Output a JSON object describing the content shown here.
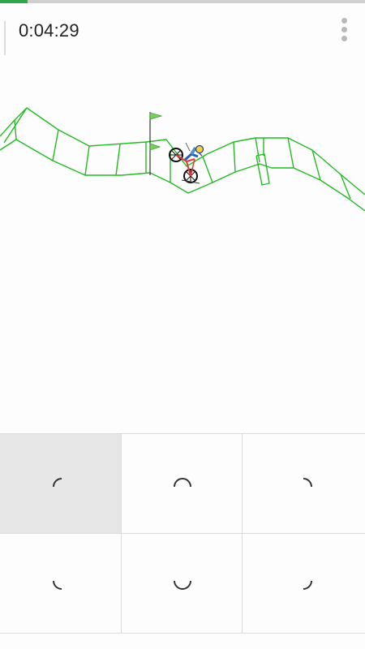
{
  "hud": {
    "timer": "0:04:29",
    "progress": 0.075,
    "progress_color": "#2ea84a"
  },
  "menu": {
    "icon": "more-vert-icon"
  },
  "track": {
    "line_color": "#22bb22"
  },
  "controls": [
    {
      "name": "control-up-left",
      "icon": "arc-up-left-icon",
      "pressed": true
    },
    {
      "name": "control-up",
      "icon": "arc-up-icon",
      "pressed": false
    },
    {
      "name": "control-up-right",
      "icon": "arc-up-right-icon",
      "pressed": false
    },
    {
      "name": "control-down-left",
      "icon": "arc-down-left-icon",
      "pressed": false
    },
    {
      "name": "control-down",
      "icon": "arc-down-icon",
      "pressed": false
    },
    {
      "name": "control-down-right",
      "icon": "arc-down-right-icon",
      "pressed": false
    }
  ]
}
